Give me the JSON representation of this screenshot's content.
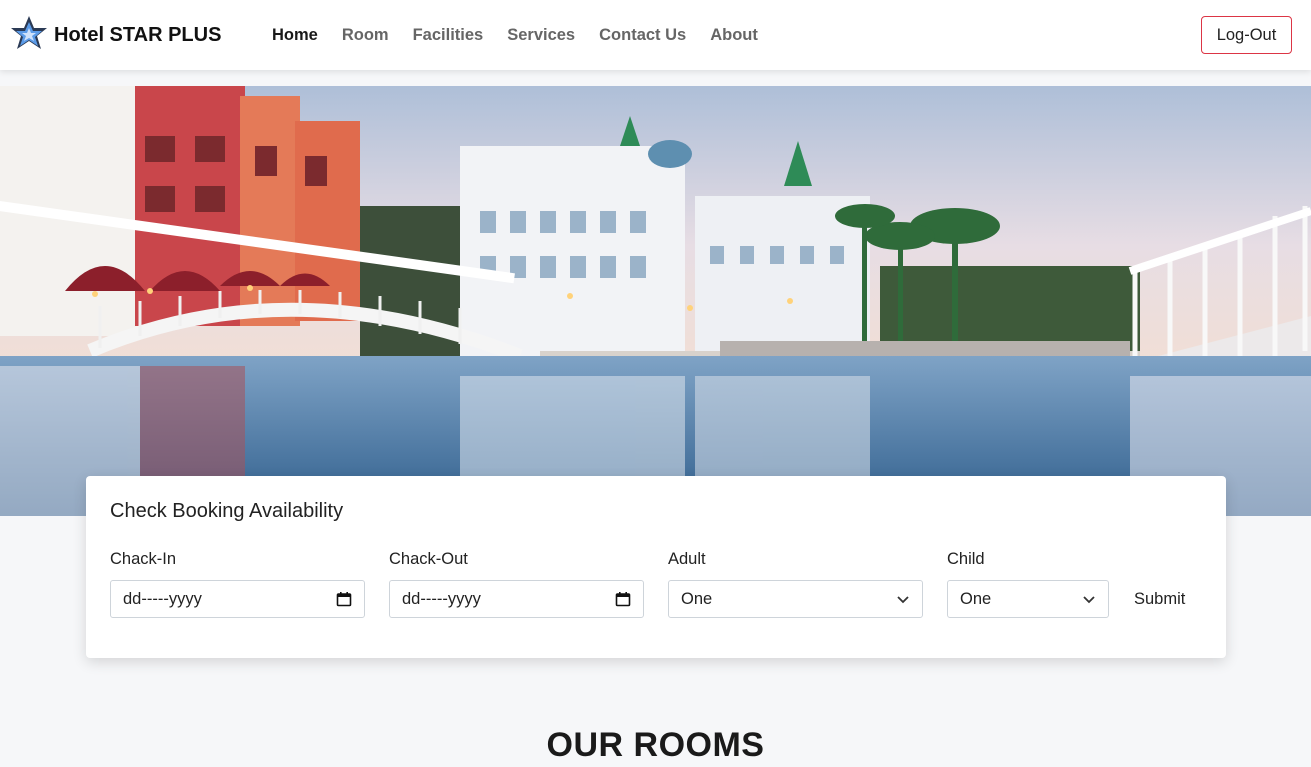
{
  "brand": {
    "name": "Hotel STAR PLUS",
    "logo_icon": "star-icon"
  },
  "nav": {
    "items": [
      {
        "label": "Home",
        "active": true
      },
      {
        "label": "Room",
        "active": false
      },
      {
        "label": "Facilities",
        "active": false
      },
      {
        "label": "Services",
        "active": false
      },
      {
        "label": "Contact Us",
        "active": false
      },
      {
        "label": "About",
        "active": false
      }
    ],
    "logout_label": "Log-Out"
  },
  "booking": {
    "title": "Check Booking Availability",
    "check_in": {
      "label": "Chack-In",
      "value": "dd-----yyyy",
      "icon": "calendar-icon"
    },
    "check_out": {
      "label": "Chack-Out",
      "value": "dd-----yyyy",
      "icon": "calendar-icon"
    },
    "adult": {
      "label": "Adult",
      "value": "One",
      "icon": "chevron-down-icon"
    },
    "child": {
      "label": "Child",
      "value": "One",
      "icon": "chevron-down-icon"
    },
    "submit_label": "Submit"
  },
  "rooms": {
    "title": "OUR ROOMS"
  },
  "colors": {
    "logout_border": "#dc3545",
    "accent_star": "#4a90e2"
  }
}
